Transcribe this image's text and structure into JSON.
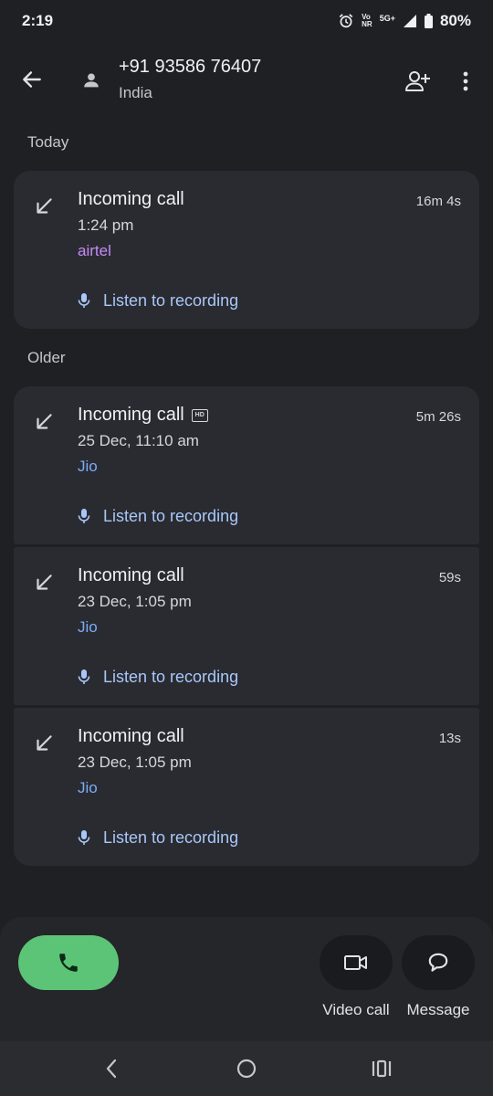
{
  "status_bar": {
    "time": "2:19",
    "network_top": "Vo",
    "network_bottom": "NR",
    "network_type": "5G+",
    "battery": "80%",
    "icons": [
      "alarm-icon",
      "volte-icon",
      "signal-icon",
      "battery-icon"
    ]
  },
  "contact": {
    "number": "+91 93586 76407",
    "country": "India"
  },
  "header_icons": [
    "back-arrow-icon",
    "person-icon",
    "add-contact-icon",
    "more-vert-icon"
  ],
  "sections": [
    {
      "title": "Today",
      "calls": [
        {
          "type": "Incoming call",
          "hd": false,
          "time": "1:24 pm",
          "carrier": "airtel",
          "carrier_color": "#c58af9",
          "duration": "16m 4s",
          "listen_label": "Listen to recording"
        }
      ]
    },
    {
      "title": "Older",
      "calls": [
        {
          "type": "Incoming call",
          "hd": true,
          "hd_label": "HD",
          "time": "25 Dec, 11:10 am",
          "carrier": "Jio",
          "carrier_color": "#7cacf8",
          "duration": "5m 26s",
          "listen_label": "Listen to recording"
        },
        {
          "type": "Incoming call",
          "hd": false,
          "time": "23 Dec, 1:05 pm",
          "carrier": "Jio",
          "carrier_color": "#7cacf8",
          "duration": "59s",
          "listen_label": "Listen to recording"
        },
        {
          "type": "Incoming call",
          "hd": false,
          "time": "23 Dec, 1:05 pm",
          "carrier": "Jio",
          "carrier_color": "#7cacf8",
          "duration": "13s",
          "listen_label": "Listen to recording"
        }
      ]
    }
  ],
  "actions": {
    "video_call_label": "Video call",
    "message_label": "Message"
  },
  "colors": {
    "background": "#1f2024",
    "card": "#2a2b30",
    "accent_blue": "#a8c7fa",
    "call_green": "#5cc476"
  },
  "nav_icons": [
    "back-nav-icon",
    "home-nav-icon",
    "recents-nav-icon"
  ]
}
